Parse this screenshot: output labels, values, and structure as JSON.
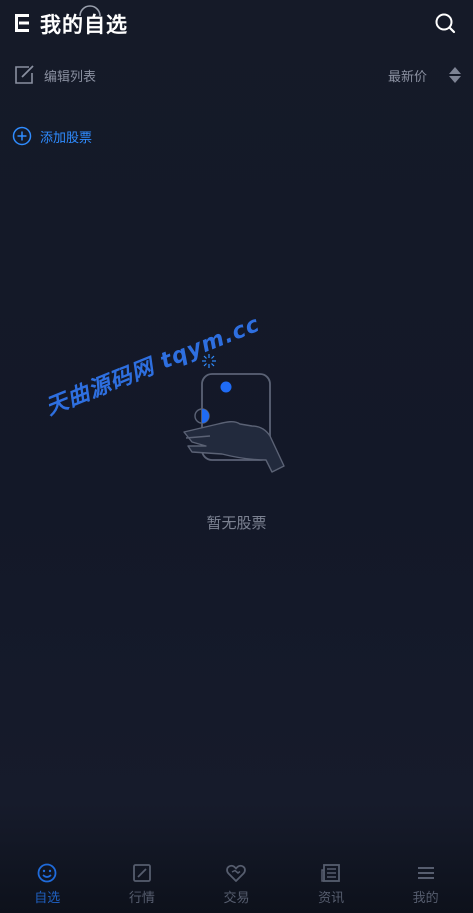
{
  "header": {
    "title": "我的自选"
  },
  "toolbar": {
    "edit_label": "编辑列表",
    "sort_label": "最新价"
  },
  "add_stock": {
    "label": "添加股票"
  },
  "empty_state": {
    "text": "暂无股票"
  },
  "watermark": {
    "text": "天曲源码网 tqym.cc"
  },
  "tabs": [
    {
      "label": "自选",
      "icon": "smile-icon",
      "active": true
    },
    {
      "label": "行情",
      "icon": "chart-box-icon",
      "active": false
    },
    {
      "label": "交易",
      "icon": "handshake-heart-icon",
      "active": false
    },
    {
      "label": "资讯",
      "icon": "newspaper-icon",
      "active": false
    },
    {
      "label": "我的",
      "icon": "menu-lines-icon",
      "active": false
    }
  ],
  "colors": {
    "accent": "#2f8cff",
    "background": "#131828",
    "muted_text": "#8a90a0",
    "inactive_tab": "#565d6e"
  }
}
